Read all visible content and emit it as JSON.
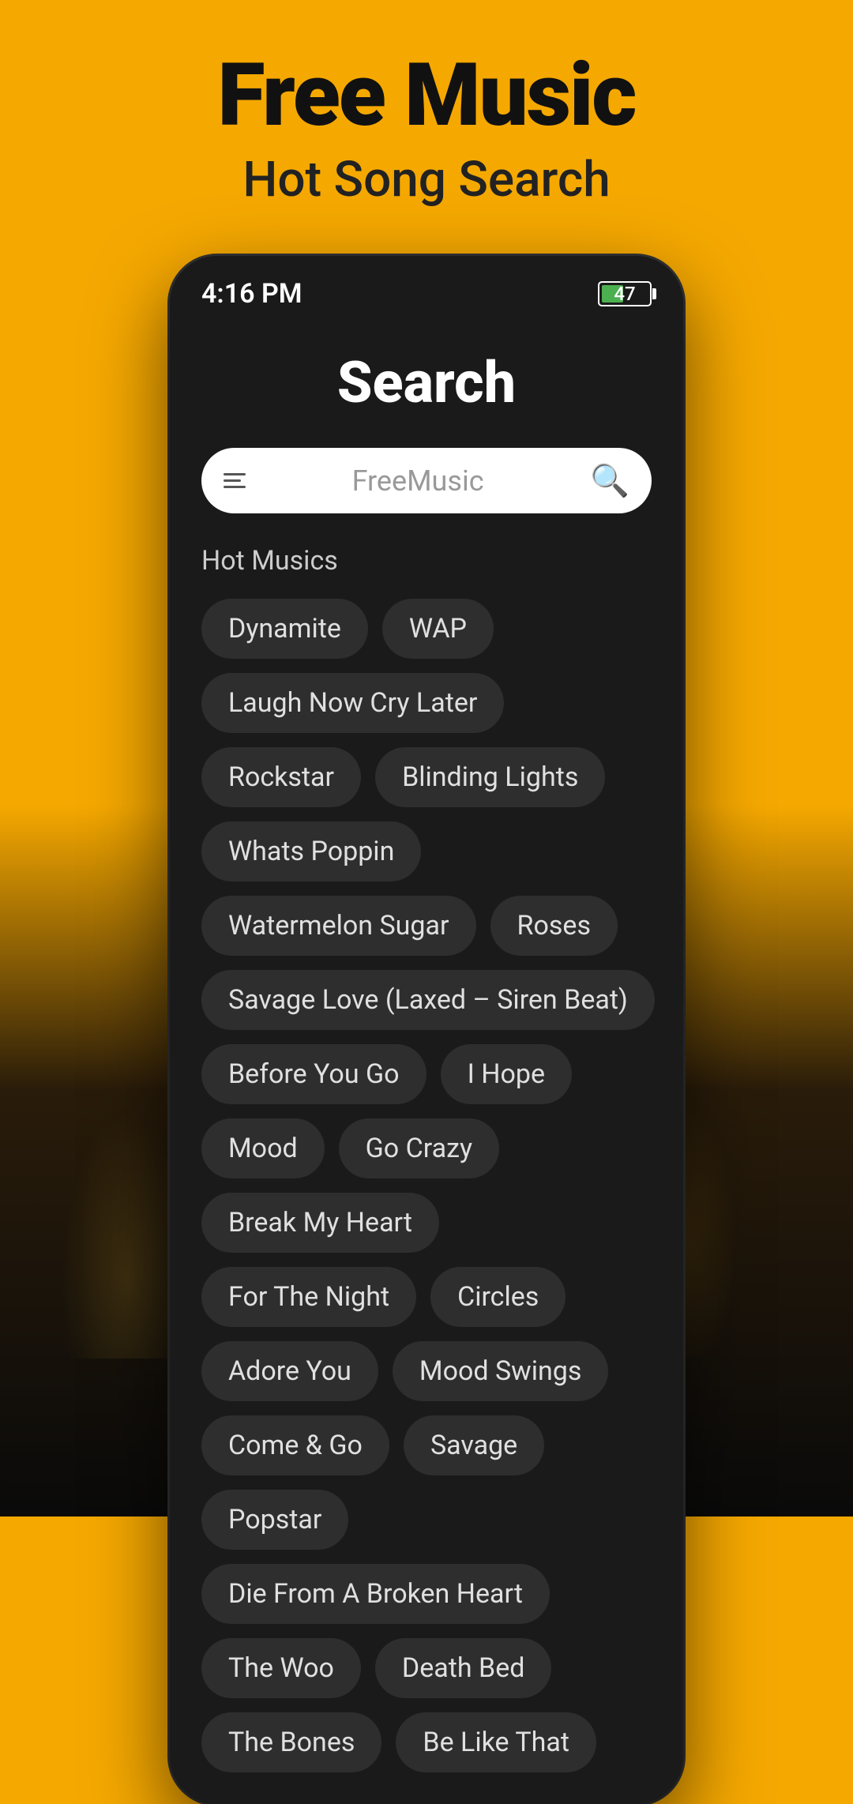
{
  "background": {
    "topColor": "#f5a800",
    "bottomColor": "#0a0a0a"
  },
  "header": {
    "title": "Free Music",
    "subtitle": "Hot Song Search"
  },
  "statusBar": {
    "time": "4:16 PM",
    "batteryPercent": "47"
  },
  "searchScreen": {
    "title": "Search",
    "searchPlaceholder": "FreeMusic",
    "menuIconLabel": "menu",
    "searchIconLabel": "search"
  },
  "hotMusics": {
    "label": "Hot Musics",
    "tags": [
      "Dynamite",
      "WAP",
      "Laugh Now Cry Later",
      "Rockstar",
      "Blinding Lights",
      "Whats Poppin",
      "Watermelon Sugar",
      "Roses",
      "Savage Love (Laxed – Siren Beat)",
      "Before You Go",
      "I Hope",
      "Mood",
      "Go Crazy",
      "Break My Heart",
      "For The Night",
      "Circles",
      "Adore You",
      "Mood Swings",
      "Come & Go",
      "Savage",
      "Popstar",
      "Die From A Broken Heart",
      "The Woo",
      "Death Bed",
      "The Bones",
      "Be Like That"
    ]
  }
}
